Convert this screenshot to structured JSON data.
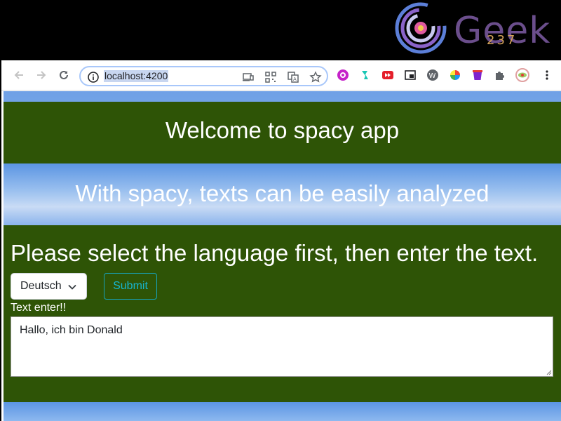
{
  "logo": {
    "text": "Geek",
    "number": "237"
  },
  "browser": {
    "url": "localhost:4200"
  },
  "page": {
    "title": "Welcome to spacy app",
    "subtitle": "With spacy, texts can be easily analyzed",
    "instruction": "Please select the language first, then enter the text.",
    "language_select": {
      "value": "Deutsch"
    },
    "submit_label": "Submit",
    "text_label": "Text enter!!",
    "text_value": "Hallo, ich bin Donald"
  },
  "colors": {
    "band": "#2e5406",
    "accent": "#17a2b8",
    "focus_ring": "#a8c7fa"
  }
}
